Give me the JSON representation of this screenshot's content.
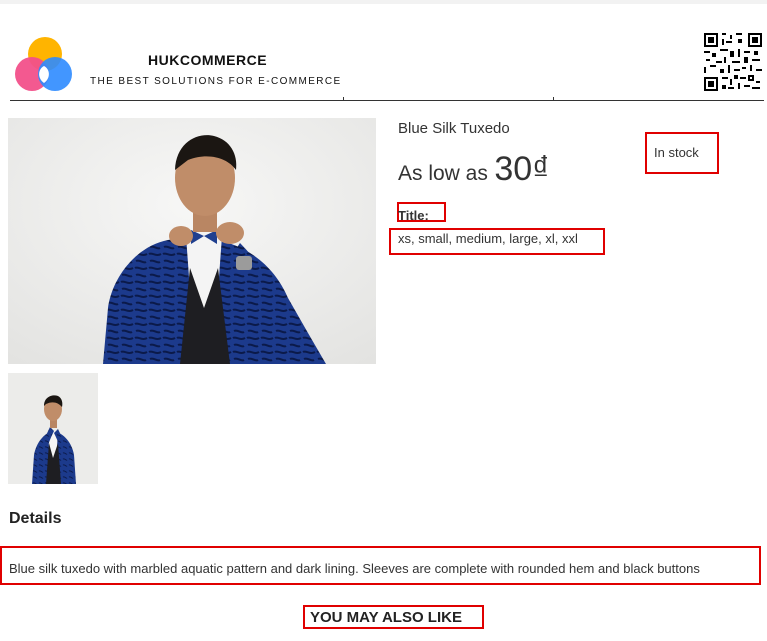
{
  "header": {
    "brand_name": "HUKCOMMERCE",
    "tagline": "THE BEST SOLUTIONS FOR E-COMMERCE",
    "logo_icon": "brand-logo",
    "qr_icon": "qr-code"
  },
  "product": {
    "name": "Blue Silk Tuxedo",
    "price_prefix": "As low as",
    "price": "30₫",
    "stock_status": "In stock",
    "option_label": "Title:",
    "option_values": "xs, small, medium, large, xl, xxl",
    "main_image_icon": "product-photo",
    "thumbnail_icon": "product-thumbnail"
  },
  "details": {
    "heading": "Details",
    "description": "Blue silk tuxedo with marbled aquatic pattern and dark lining. Sleeves are complete with rounded hem and black buttons"
  },
  "related": {
    "heading": "YOU MAY ALSO LIKE"
  },
  "colors": {
    "annotation_red": "#e00000",
    "jacket_blue": "#1c3a8c"
  }
}
